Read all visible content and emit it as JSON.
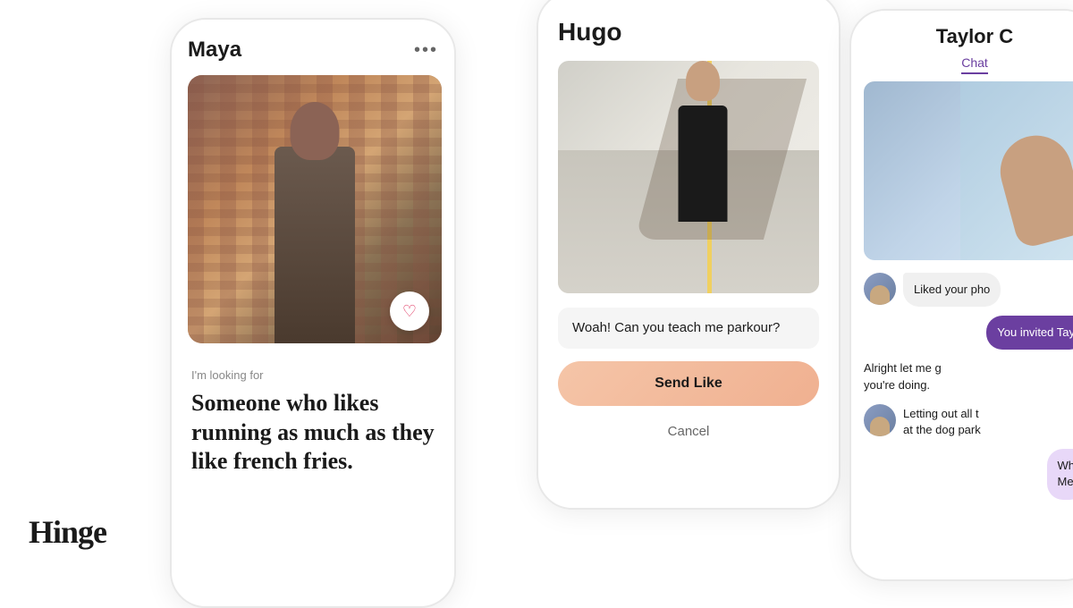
{
  "logo": {
    "text": "Hinge"
  },
  "phone_maya": {
    "profile_name": "Maya",
    "dots": "...",
    "looking_for_label": "I'm looking for",
    "looking_for_text": "Someone who likes running as much as they like french fries."
  },
  "phone_hugo": {
    "profile_name": "Hugo",
    "message_placeholder": "Woah! Can you teach me parkour?",
    "send_like_label": "Send Like",
    "cancel_label": "Cancel"
  },
  "phone_chat": {
    "chat_name": "Taylor C",
    "chat_tab": "Chat",
    "messages": [
      {
        "type": "other",
        "text": "Liked your pho"
      },
      {
        "type": "self",
        "text": "You invited Tay"
      },
      {
        "type": "plain",
        "text": "Alright let me g you're doing."
      },
      {
        "type": "plain",
        "text": "Letting out all t at the dog park"
      },
      {
        "type": "self-light",
        "text": "Wh Me"
      }
    ]
  }
}
